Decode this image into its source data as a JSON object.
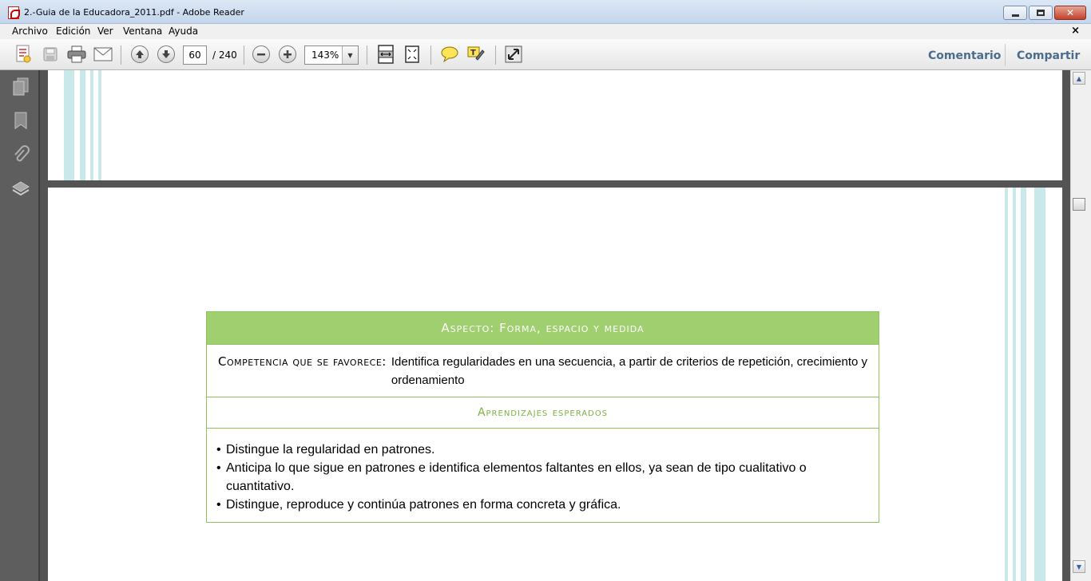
{
  "window": {
    "title": "2.-Guia de la Educadora_2011.pdf - Adobe Reader"
  },
  "menu": {
    "items": [
      "Archivo",
      "Edición",
      "Ver",
      "Ventana",
      "Ayuda"
    ],
    "close_glyph": "×"
  },
  "toolbar": {
    "page_current": "60",
    "page_total": "/ 240",
    "zoom": "143%",
    "comment_label": "Comentario",
    "share_label": "Compartir"
  },
  "document": {
    "aspect_header": "Aspecto: Forma, espacio y medida",
    "competencia_label": "Competencia que se favorece:",
    "competencia_text": "Identifica regularidades en una secuencia, a partir de criterios de repetición, crecimiento y ordenamiento",
    "aprendizajes_header": "Aprendizajes esperados",
    "aprendizajes": [
      "Distingue la regularidad en patrones.",
      "Anticipa lo que sigue en patrones e identifica elementos faltantes en ellos, ya sean de tipo cualitativo o cuantitativo.",
      "Distingue, reproduce y continúa patrones en forma concreta y gráfica."
    ],
    "bullet": "•"
  },
  "colors": {
    "table_green": "#9fcf6e",
    "subheader_green": "#7cb342",
    "stripe_teal": "#c9e8ea"
  }
}
